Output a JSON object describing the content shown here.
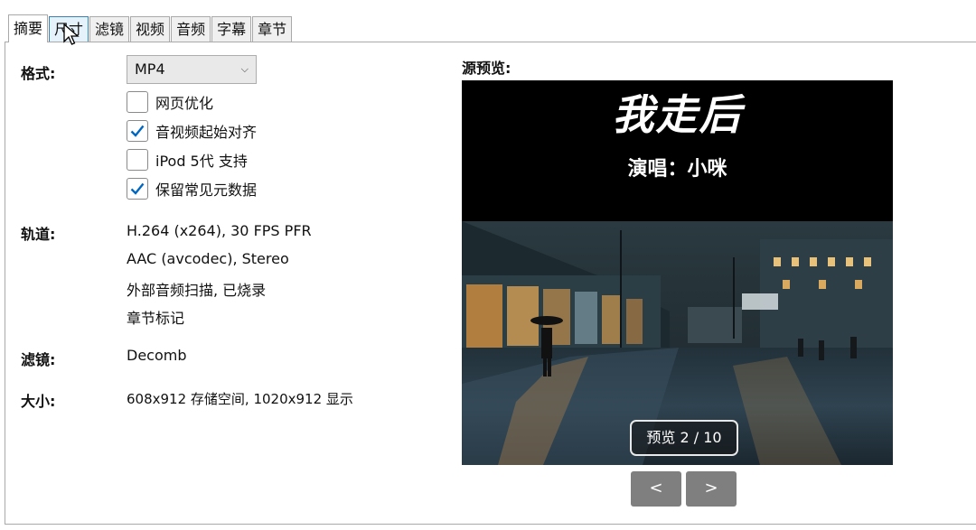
{
  "tabs": [
    "摘要",
    "尺寸",
    "滤镜",
    "视频",
    "音频",
    "字幕",
    "章节"
  ],
  "format": {
    "label": "格式:",
    "value": "MP4"
  },
  "options": [
    {
      "label": "网页优化",
      "checked": false
    },
    {
      "label": "音视频起始对齐",
      "checked": true
    },
    {
      "label": "iPod 5代 支持",
      "checked": false
    },
    {
      "label": "保留常见元数据",
      "checked": true
    }
  ],
  "tracks": {
    "label": "轨道:",
    "items": [
      "H.264 (x264), 30 FPS PFR",
      "AAC (avcodec), Stereo",
      "外部音频扫描, 已烧录",
      "章节标记"
    ]
  },
  "filters": {
    "label": "滤镜:",
    "value": "Decomb"
  },
  "size": {
    "label": "大小:",
    "value": "608x912 存储空间, 1020x912 显示"
  },
  "preview": {
    "label": "源预览:",
    "title": "我走后",
    "singer": "演唱：小咪",
    "counter": "预览 2 / 10",
    "prev": "<",
    "next": ">"
  },
  "colors": {
    "accent": "#0067c0",
    "nav_button": "#7f7f7f"
  }
}
